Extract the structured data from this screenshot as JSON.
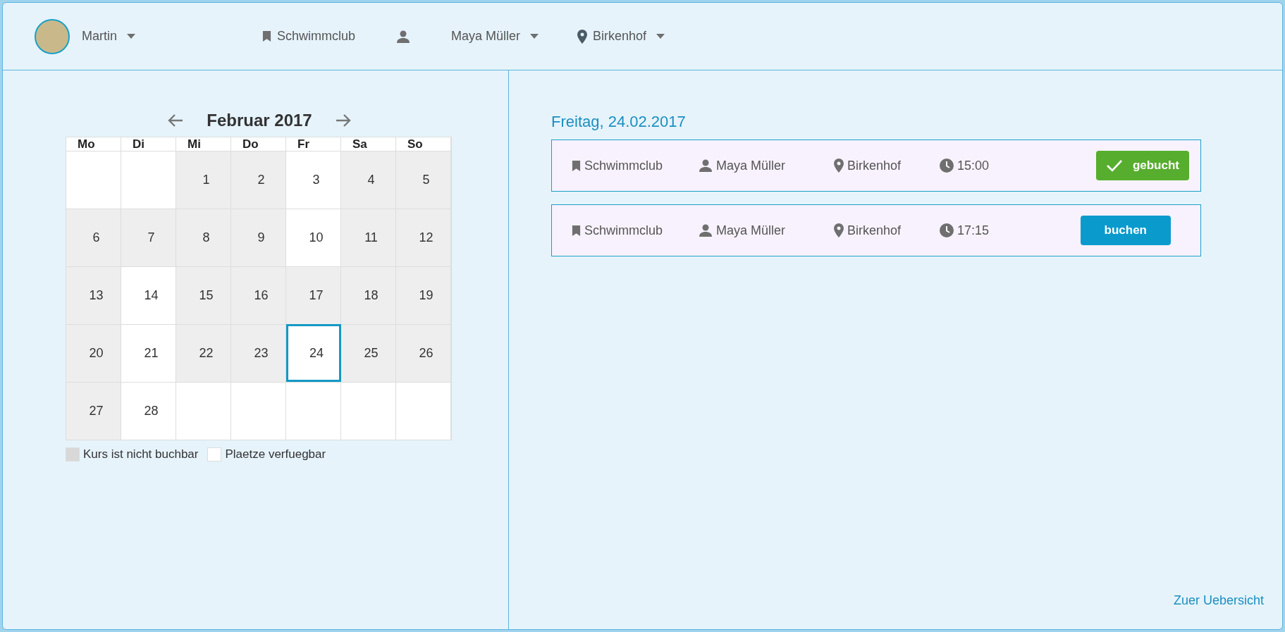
{
  "header": {
    "user": {
      "name": "Martin"
    },
    "club": "Schwimmclub",
    "trainer": "Maya Müller",
    "location": "Birkenhof"
  },
  "calendar": {
    "title": "Februar 2017",
    "weekdays": [
      "Mo",
      "Di",
      "Mi",
      "Do",
      "Fr",
      "Sa",
      "So"
    ],
    "weeks": [
      [
        {
          "kind": "empty"
        },
        {
          "kind": "empty"
        },
        {
          "kind": "day",
          "day": "1",
          "bookable": false,
          "selected": false
        },
        {
          "kind": "day",
          "day": "2",
          "bookable": false,
          "selected": false
        },
        {
          "kind": "day",
          "day": "3",
          "bookable": true,
          "selected": false
        },
        {
          "kind": "day",
          "day": "4",
          "bookable": false,
          "selected": false
        },
        {
          "kind": "day",
          "day": "5",
          "bookable": false,
          "selected": false
        }
      ],
      [
        {
          "kind": "day",
          "day": "6",
          "bookable": false,
          "selected": false
        },
        {
          "kind": "day",
          "day": "7",
          "bookable": false,
          "selected": false
        },
        {
          "kind": "day",
          "day": "8",
          "bookable": false,
          "selected": false
        },
        {
          "kind": "day",
          "day": "9",
          "bookable": false,
          "selected": false
        },
        {
          "kind": "day",
          "day": "10",
          "bookable": true,
          "selected": false
        },
        {
          "kind": "day",
          "day": "11",
          "bookable": false,
          "selected": false
        },
        {
          "kind": "day",
          "day": "12",
          "bookable": false,
          "selected": false
        }
      ],
      [
        {
          "kind": "day",
          "day": "13",
          "bookable": false,
          "selected": false
        },
        {
          "kind": "day",
          "day": "14",
          "bookable": true,
          "selected": false
        },
        {
          "kind": "day",
          "day": "15",
          "bookable": false,
          "selected": false
        },
        {
          "kind": "day",
          "day": "16",
          "bookable": false,
          "selected": false
        },
        {
          "kind": "day",
          "day": "17",
          "bookable": false,
          "selected": false
        },
        {
          "kind": "day",
          "day": "18",
          "bookable": false,
          "selected": false
        },
        {
          "kind": "day",
          "day": "19",
          "bookable": false,
          "selected": false
        }
      ],
      [
        {
          "kind": "day",
          "day": "20",
          "bookable": false,
          "selected": false
        },
        {
          "kind": "day",
          "day": "21",
          "bookable": true,
          "selected": false
        },
        {
          "kind": "day",
          "day": "22",
          "bookable": false,
          "selected": false
        },
        {
          "kind": "day",
          "day": "23",
          "bookable": false,
          "selected": false
        },
        {
          "kind": "day",
          "day": "24",
          "bookable": true,
          "selected": true
        },
        {
          "kind": "day",
          "day": "25",
          "bookable": false,
          "selected": false
        },
        {
          "kind": "day",
          "day": "26",
          "bookable": false,
          "selected": false
        }
      ],
      [
        {
          "kind": "day",
          "day": "27",
          "bookable": false,
          "selected": false
        },
        {
          "kind": "day",
          "day": "28",
          "bookable": true,
          "selected": false
        },
        {
          "kind": "empty"
        },
        {
          "kind": "empty"
        },
        {
          "kind": "empty"
        },
        {
          "kind": "empty"
        },
        {
          "kind": "empty"
        }
      ]
    ],
    "legend": [
      {
        "label": "Kurs ist nicht buchbar",
        "bookable": false
      },
      {
        "label": "Plaetze verfuegbar",
        "bookable": true
      }
    ]
  },
  "day_view": {
    "title": "Freitag, 24.02.2017",
    "sessions": [
      {
        "club": "Schwimmclub",
        "trainer": "Maya Müller",
        "location": "Birkenhof",
        "time": "15:00",
        "booked": true,
        "action": "gebucht"
      },
      {
        "club": "Schwimmclub",
        "trainer": "Maya Müller",
        "location": "Birkenhof",
        "time": "17:15",
        "booked": false,
        "action": "buchen"
      }
    ]
  },
  "overview_link": "Zuer Uebersicht"
}
